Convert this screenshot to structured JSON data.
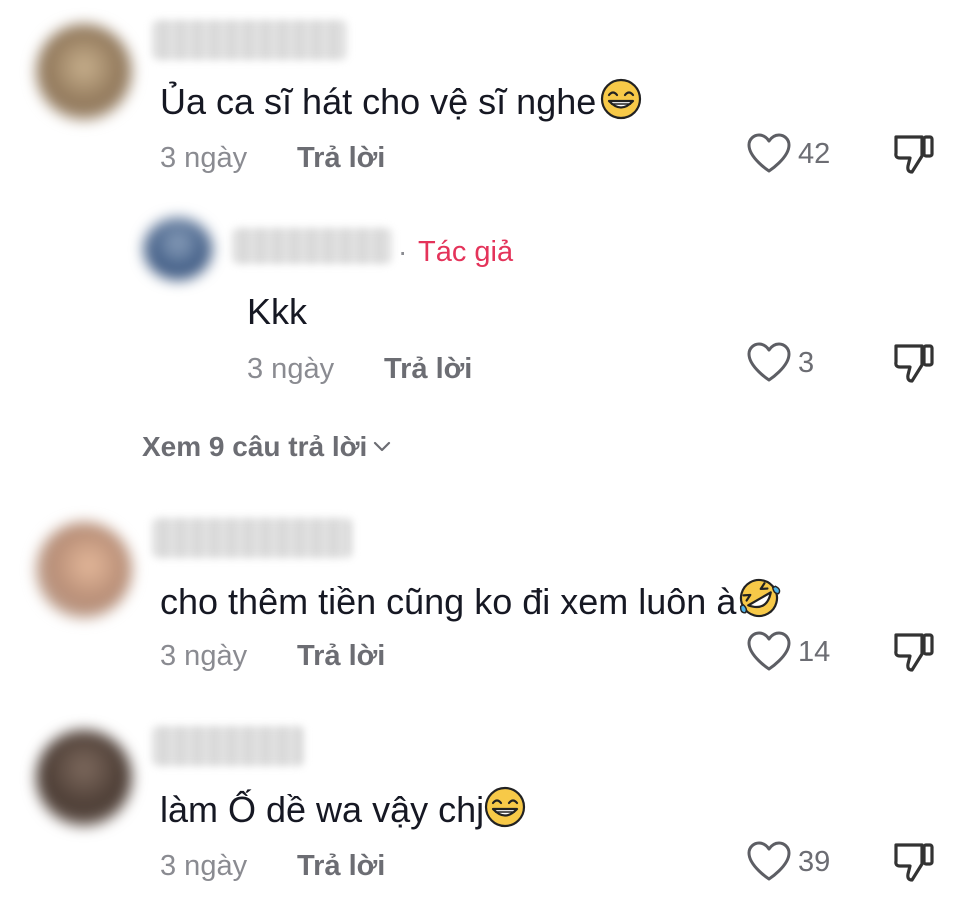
{
  "comments": [
    {
      "text": "Ủa ca sĩ hát cho vệ sĩ nghe",
      "emoji": "grin",
      "date": "3 ngày",
      "reply_label": "Trả lời",
      "likes": "42",
      "replies": [
        {
          "author_tag": "Tác giả",
          "separator": "·",
          "text": "Kkk",
          "date": "3 ngày",
          "reply_label": "Trả lời",
          "likes": "3"
        }
      ],
      "view_replies": "Xem 9 câu trả lời"
    },
    {
      "text": "cho thêm tiền cũng ko đi xem luôn à",
      "emoji": "rofl",
      "date": "3 ngày",
      "reply_label": "Trả lời",
      "likes": "14"
    },
    {
      "text": "làm Ố dề wa vậy chj",
      "emoji": "grin",
      "date": "3 ngày",
      "reply_label": "Trả lời",
      "likes": "39"
    }
  ],
  "colors": {
    "author_tag": "#e4335a",
    "meta": "#8a8b91",
    "text": "#161823"
  },
  "icons": [
    "heart-outline-icon",
    "thumbs-down-icon",
    "chevron-down-icon",
    "grinning-emoji-icon",
    "rofl-emoji-icon"
  ]
}
